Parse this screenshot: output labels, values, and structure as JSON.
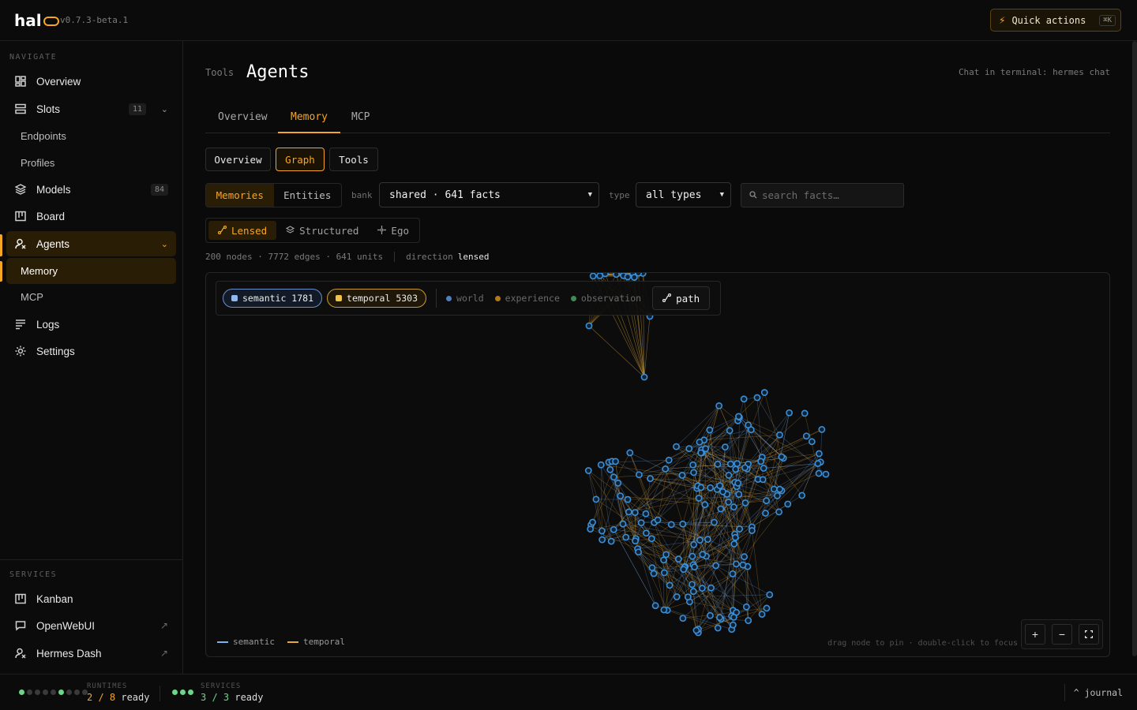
{
  "brand": {
    "logo_text": "hal",
    "version": "v0.7.3-beta.1"
  },
  "quick_actions": {
    "label": "Quick actions",
    "shortcut": "⌘K"
  },
  "sidebar": {
    "navigate_heading": "NAVIGATE",
    "services_heading": "SERVICES",
    "overview": "Overview",
    "slots": "Slots",
    "slots_count": "11",
    "endpoints": "Endpoints",
    "profiles": "Profiles",
    "models": "Models",
    "models_count": "84",
    "board": "Board",
    "agents": "Agents",
    "memory": "Memory",
    "mcp": "MCP",
    "logs": "Logs",
    "settings": "Settings",
    "kanban": "Kanban",
    "openwebui": "OpenWebUI",
    "hermes_dash": "Hermes Dash"
  },
  "header": {
    "breadcrumb": "Tools",
    "title": "Agents",
    "hint": "Chat in terminal: hermes chat"
  },
  "tabs": [
    "Overview",
    "Memory",
    "MCP"
  ],
  "subtabs": [
    "Overview",
    "Graph",
    "Tools"
  ],
  "mode": {
    "memories": "Memories",
    "entities": "Entities"
  },
  "bank": {
    "label": "bank",
    "value": "shared · 641 facts"
  },
  "type_filter": {
    "label": "type",
    "value": "all types"
  },
  "search": {
    "placeholder": "search facts…"
  },
  "lens": {
    "lensed": "Lensed",
    "structured": "Structured",
    "ego": "Ego"
  },
  "stats": {
    "text": "200 nodes · 7772 edges · 641 units",
    "direction_label": "direction",
    "direction_value": "lensed"
  },
  "graph": {
    "chip_semantic": "semantic 1781",
    "chip_temporal": "temporal 5303",
    "world": "world",
    "experience": "experience",
    "observation": "observation",
    "path": "path",
    "legend_semantic": "semantic",
    "legend_temporal": "temporal",
    "hint": "drag node to pin · double-click to focus",
    "colors": {
      "semantic": "#7fb1f0",
      "temporal": "#e2a93b",
      "node": "#3b8fd6",
      "world": "#4f7fbf",
      "experience": "#b07a1c",
      "observation": "#3f8a55"
    }
  },
  "footer": {
    "runtimes_label": "RUNTIMES",
    "runtimes_value": "2 / 8",
    "runtimes_suffix": "ready",
    "services_label": "SERVICES",
    "services_value": "3 / 3",
    "services_suffix": "ready",
    "journal": "^ journal"
  }
}
